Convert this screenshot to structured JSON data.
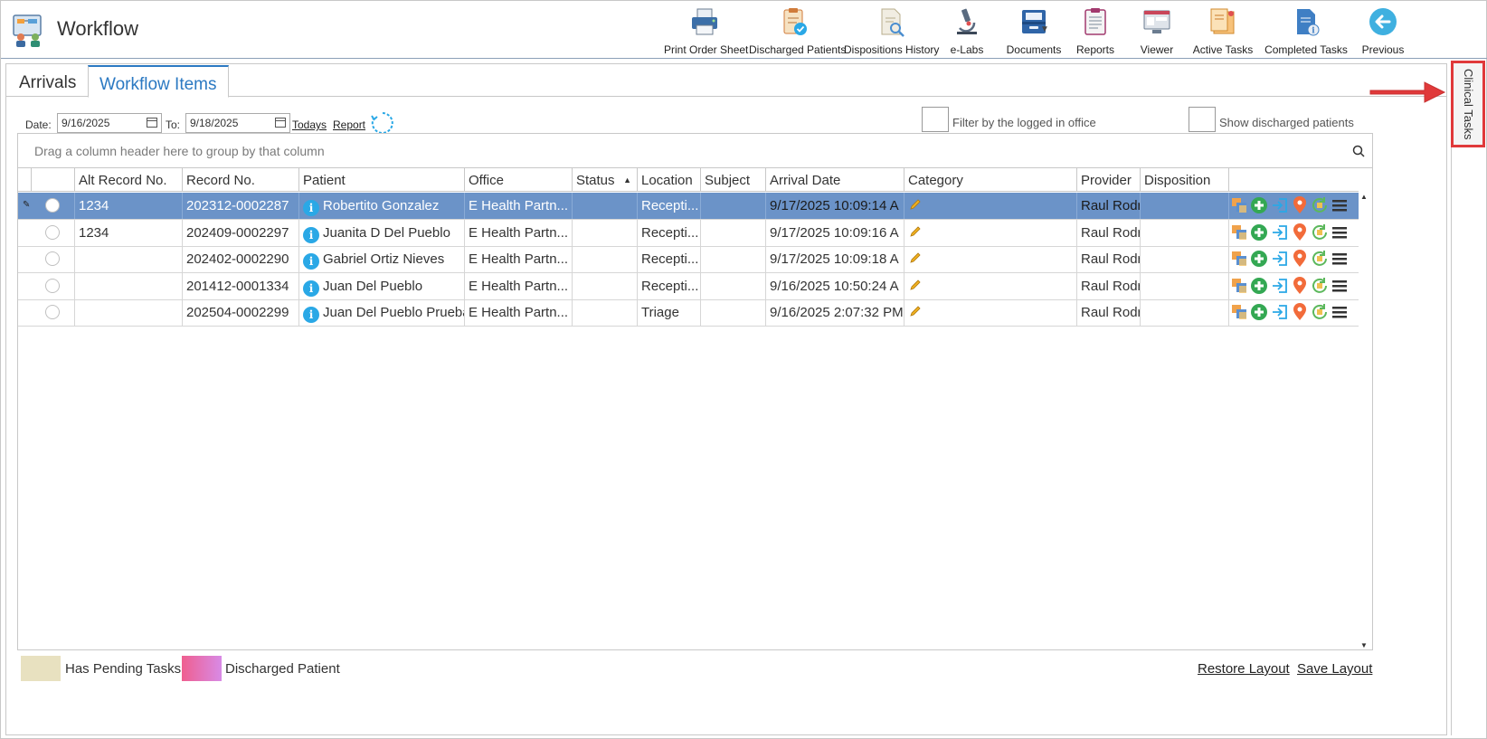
{
  "app": {
    "title": "Workflow"
  },
  "toolbar": {
    "print_order_sheet": "Print Order Sheet",
    "discharged_patients": "Discharged Patients",
    "dispositions_history": "Dispositions History",
    "elabs": "e-Labs",
    "documents": "Documents",
    "reports": "Reports",
    "viewer": "Viewer",
    "active_tasks": "Active Tasks",
    "completed_tasks": "Completed Tasks",
    "previous": "Previous"
  },
  "tabs": {
    "arrivals": "Arrivals",
    "workflow_items": "Workflow Items"
  },
  "filters": {
    "date_label": "Date:",
    "date_from": "9/16/2025",
    "to_label": "To:",
    "date_to": "9/18/2025",
    "todays_link": "Todays",
    "report_link": "Report",
    "filter_office_label": "Filter by the logged in office",
    "show_discharged_label": "Show discharged patients"
  },
  "grid": {
    "group_prompt": "Drag a column header here to group by that column",
    "columns": {
      "alt_record": "Alt Record No.",
      "record": "Record No.",
      "patient": "Patient",
      "office": "Office",
      "status": "Status",
      "location": "Location",
      "subject": "Subject",
      "arrival_date": "Arrival Date",
      "category": "Category",
      "provider": "Provider",
      "disposition": "Disposition"
    },
    "rows": [
      {
        "alt_record": "1234",
        "record": "202312-0002287",
        "patient": "Robertito Gonzalez",
        "office": "E Health Partn...",
        "status": "",
        "location": "Recepti...",
        "subject": "",
        "arrival_date": "9/17/2025 10:09:14 A",
        "provider": "Raul Rodri",
        "disposition": ""
      },
      {
        "alt_record": "1234",
        "record": "202409-0002297",
        "patient": "Juanita D Del Pueblo",
        "office": "E Health Partn...",
        "status": "",
        "location": "Recepti...",
        "subject": "",
        "arrival_date": "9/17/2025 10:09:16 A",
        "provider": "Raul Rodri",
        "disposition": ""
      },
      {
        "alt_record": "",
        "record": "202402-0002290",
        "patient": "Gabriel Ortiz Nieves",
        "office": "E Health Partn...",
        "status": "",
        "location": "Recepti...",
        "subject": "",
        "arrival_date": "9/17/2025 10:09:18 A",
        "provider": "Raul Rodri",
        "disposition": ""
      },
      {
        "alt_record": "",
        "record": "201412-0001334",
        "patient": "Juan Del Pueblo",
        "office": "E Health Partn...",
        "status": "",
        "location": "Recepti...",
        "subject": "",
        "arrival_date": "9/16/2025 10:50:24 A",
        "provider": "Raul Rodri",
        "disposition": ""
      },
      {
        "alt_record": "",
        "record": "202504-0002299",
        "patient": "Juan Del Pueblo Prueba",
        "office": "E Health Partn...",
        "status": "",
        "location": "Triage",
        "subject": "",
        "arrival_date": "9/16/2025 2:07:32 PM",
        "provider": "Raul Rodri",
        "disposition": ""
      }
    ]
  },
  "legend": {
    "pending_tasks": "Has Pending Tasks",
    "discharged_patient": "Discharged Patient",
    "pending_color": "#e8e1c0",
    "discharged_color_start": "#ef5f8f",
    "discharged_color_end": "#d88ae6"
  },
  "footer": {
    "restore_layout": "Restore Layout",
    "save_layout": "Save Layout"
  },
  "side_panel": {
    "clinical_tasks": "Clinical Tasks"
  },
  "colors": {
    "selected_row": "#6b93c8",
    "accent": "#2b79c2",
    "annotation": "#e0393a"
  },
  "icons": [
    "printer-icon",
    "discharged-clipboard-icon",
    "dispositions-history-icon",
    "microscope-icon",
    "documents-tray-icon",
    "reports-icon",
    "viewer-icon",
    "active-tasks-icon",
    "completed-tasks-icon",
    "previous-arrow-icon"
  ]
}
